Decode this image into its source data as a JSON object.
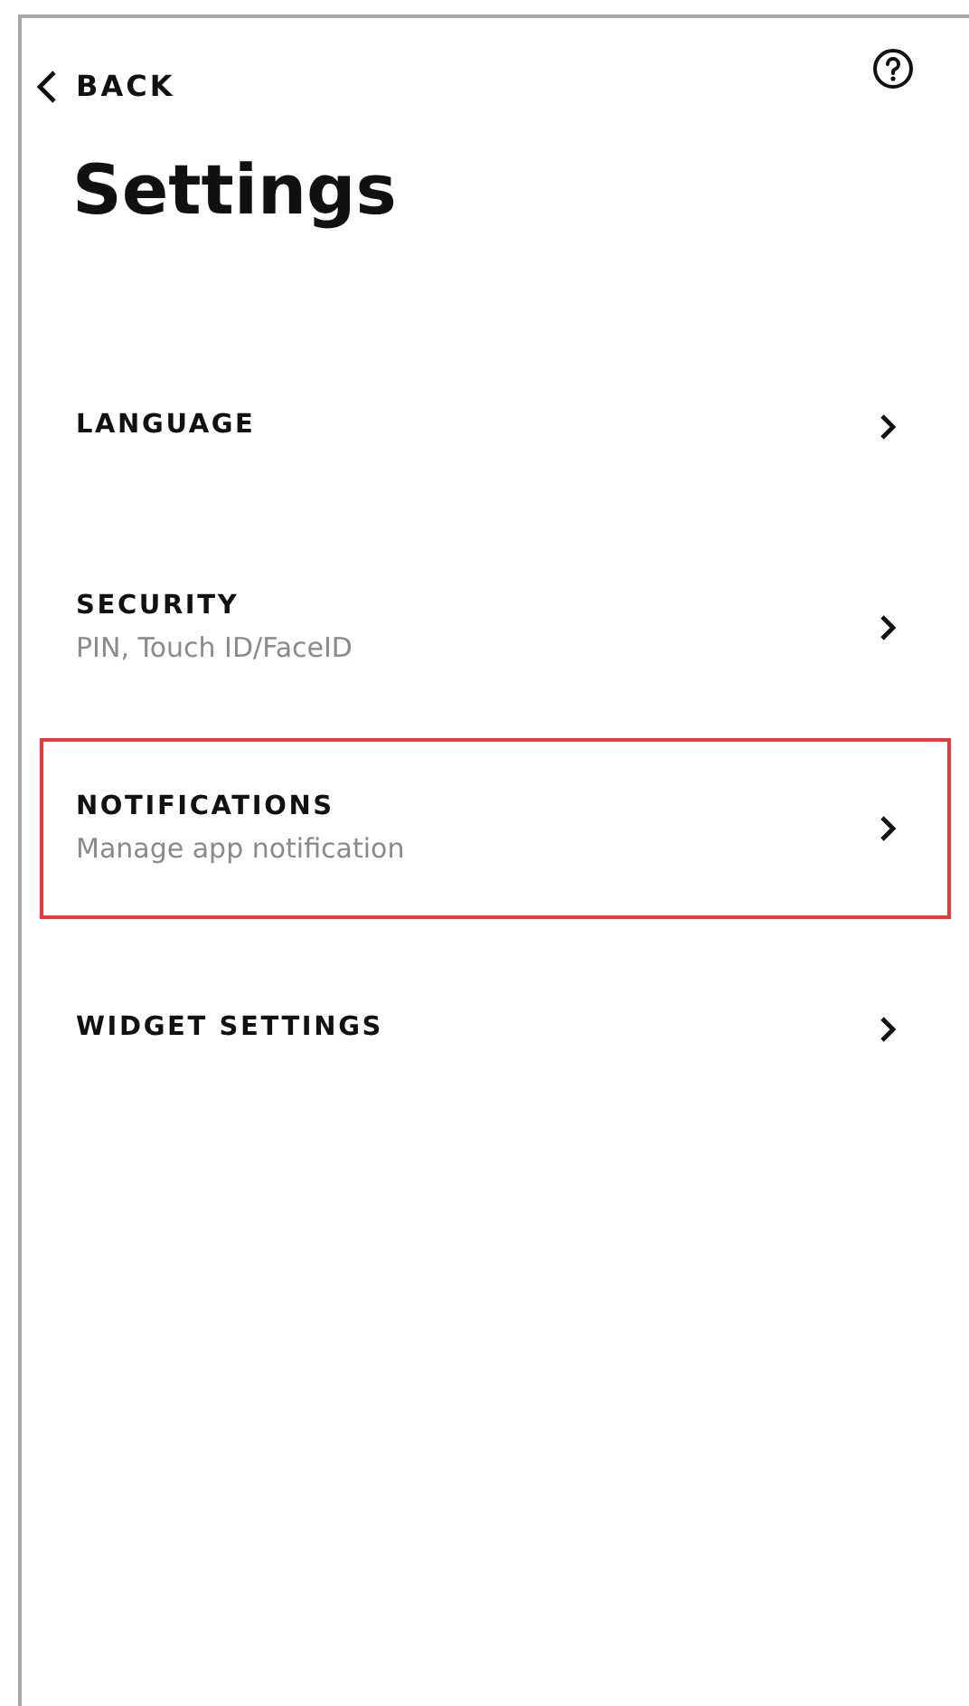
{
  "header": {
    "back_label": "BACK"
  },
  "title": "Settings",
  "items": [
    {
      "label": "LANGUAGE",
      "highlighted": false
    },
    {
      "label": "SECURITY",
      "subtitle": "PIN, Touch ID/FaceID",
      "highlighted": false
    },
    {
      "label": "NOTIFICATIONS",
      "subtitle": "Manage app notification",
      "highlighted": true
    },
    {
      "label": "WIDGET SETTINGS",
      "highlighted": false
    }
  ]
}
